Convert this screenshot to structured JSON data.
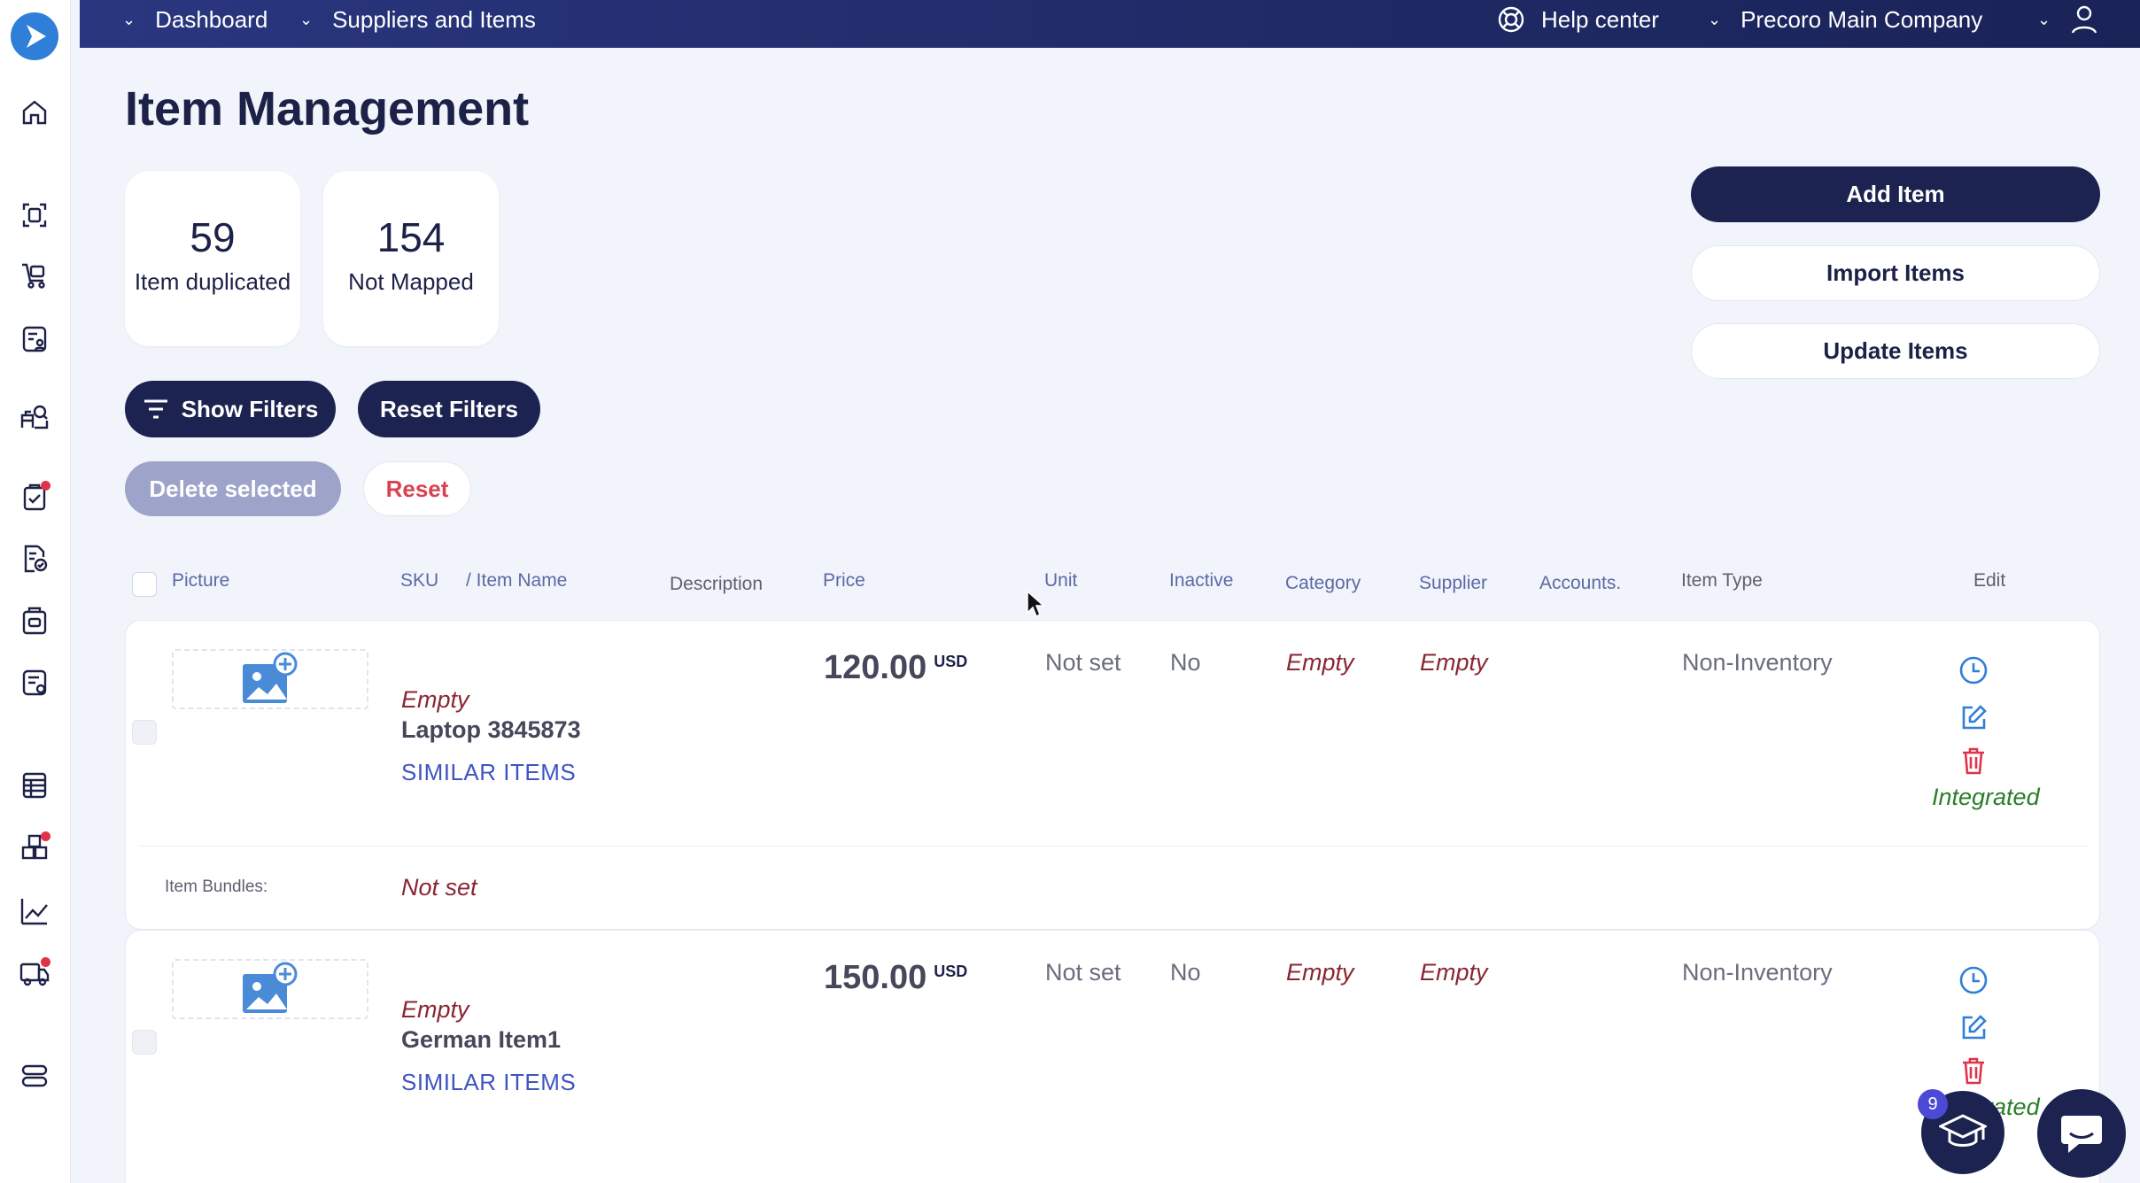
{
  "topbar": {
    "dashboard": "Dashboard",
    "suppliers_and_items": "Suppliers and Items",
    "help_center": "Help center",
    "company": "Precoro Main Company"
  },
  "page": {
    "title": "Item Management"
  },
  "stats": [
    {
      "value": "59",
      "label": "Item duplicated"
    },
    {
      "value": "154",
      "label": "Not Mapped"
    }
  ],
  "actions": {
    "add_item": "Add Item",
    "import_items": "Import Items",
    "update_items": "Update Items",
    "show_filters": "Show Filters",
    "reset_filters": "Reset Filters",
    "delete_selected": "Delete selected",
    "reset": "Reset"
  },
  "table": {
    "headers": {
      "picture": "Picture",
      "sku": "SKU",
      "item_name": "/ Item Name",
      "description": "Description",
      "price": "Price",
      "unit": "Unit",
      "inactive": "Inactive",
      "category": "Category",
      "supplier": "Supplier",
      "accounts": "Accounts.",
      "item_type": "Item Type",
      "edit": "Edit"
    },
    "rows": [
      {
        "sku": "Empty",
        "name": "Laptop 3845873",
        "similar": "SIMILAR ITEMS",
        "price": "120.00",
        "currency": "USD",
        "unit": "Not set",
        "inactive": "No",
        "category": "Empty",
        "supplier": "Empty",
        "item_type": "Non-Inventory",
        "status": "Integrated",
        "bundles_label": "Item Bundles:",
        "bundles_value": "Not set"
      },
      {
        "sku": "Empty",
        "name": "German Item1",
        "similar": "SIMILAR ITEMS",
        "price": "150.00",
        "currency": "USD",
        "unit": "Not set",
        "inactive": "No",
        "category": "Empty",
        "supplier": "Empty",
        "item_type": "Non-Inventory",
        "status": "Integrated"
      }
    ]
  },
  "floating": {
    "learn_badge": "9"
  },
  "colors": {
    "navy": "#1c2350",
    "accent_blue": "#2f7fd8",
    "danger": "#d9434f",
    "success": "#2a7d2a"
  }
}
